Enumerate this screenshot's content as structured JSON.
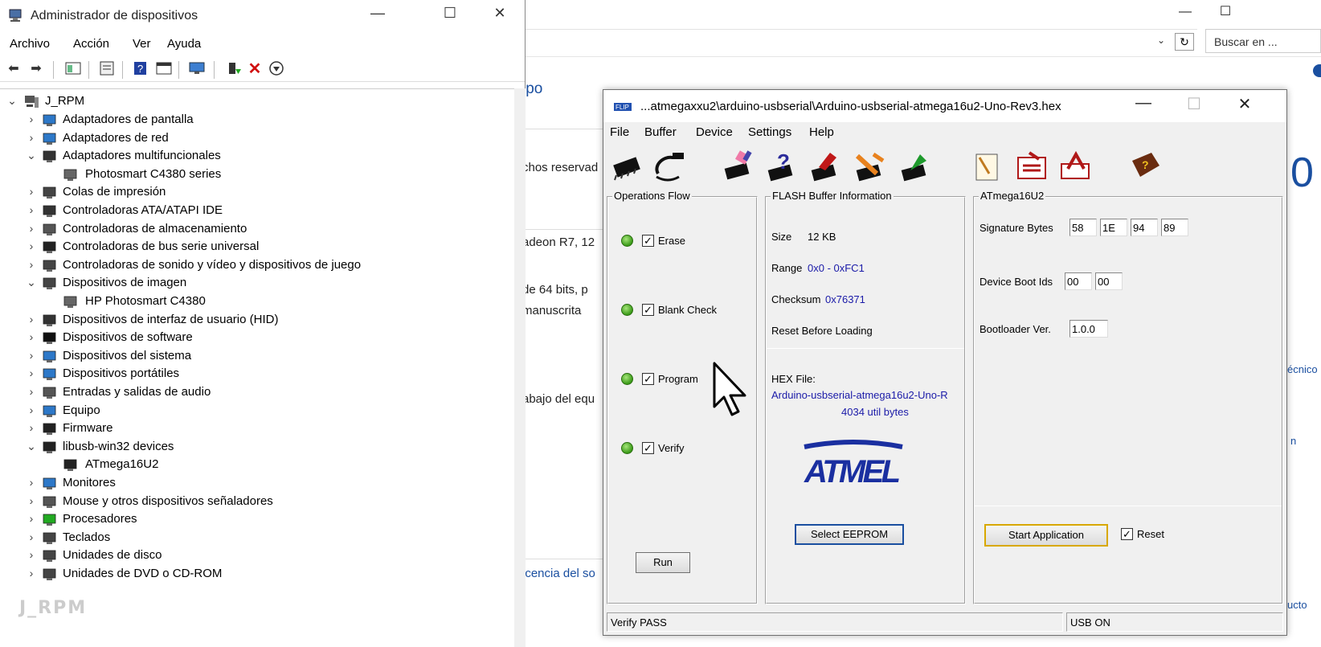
{
  "background_window": {
    "search_placeholder": "Buscar en ...",
    "snippets": [
      "ipo",
      "chos reservad",
      "adeon R7, 12",
      "de 64 bits, p",
      "manuscrita",
      "abajo del equ",
      "icencia del so",
      "0"
    ],
    "links": [
      "écnico",
      "n",
      "ucto"
    ]
  },
  "device_manager": {
    "title": "Administrador de dispositivos",
    "menu": [
      "Archivo",
      "Acción",
      "Ver",
      "Ayuda"
    ],
    "root": "J_RPM",
    "items": [
      {
        "label": "Adaptadores de pantalla",
        "expanded": false,
        "level": 1,
        "icon": "display-adapter-icon"
      },
      {
        "label": "Adaptadores de red",
        "expanded": false,
        "level": 1,
        "icon": "network-adapter-icon"
      },
      {
        "label": "Adaptadores multifuncionales",
        "expanded": true,
        "level": 1,
        "icon": "multifunction-icon"
      },
      {
        "label": "Photosmart C4380 series",
        "level": 2,
        "icon": "printer-device-icon"
      },
      {
        "label": "Colas de impresión",
        "expanded": false,
        "level": 1,
        "icon": "print-queue-icon"
      },
      {
        "label": "Controladoras ATA/ATAPI IDE",
        "expanded": false,
        "level": 1,
        "icon": "ide-controller-icon"
      },
      {
        "label": "Controladoras de almacenamiento",
        "expanded": false,
        "level": 1,
        "icon": "storage-controller-icon"
      },
      {
        "label": "Controladoras de bus serie universal",
        "expanded": false,
        "level": 1,
        "icon": "usb-controller-icon"
      },
      {
        "label": "Controladoras de sonido y vídeo y dispositivos de juego",
        "expanded": false,
        "level": 1,
        "icon": "sound-icon"
      },
      {
        "label": "Dispositivos de imagen",
        "expanded": true,
        "level": 1,
        "icon": "imaging-device-icon"
      },
      {
        "label": "HP Photosmart C4380",
        "level": 2,
        "icon": "scanner-icon"
      },
      {
        "label": "Dispositivos de interfaz de usuario (HID)",
        "expanded": false,
        "level": 1,
        "icon": "hid-icon"
      },
      {
        "label": "Dispositivos de software",
        "expanded": false,
        "level": 1,
        "icon": "software-device-icon"
      },
      {
        "label": "Dispositivos del sistema",
        "expanded": false,
        "level": 1,
        "icon": "system-device-icon"
      },
      {
        "label": "Dispositivos portátiles",
        "expanded": false,
        "level": 1,
        "icon": "portable-device-icon"
      },
      {
        "label": "Entradas y salidas de audio",
        "expanded": false,
        "level": 1,
        "icon": "audio-io-icon"
      },
      {
        "label": "Equipo",
        "expanded": false,
        "level": 1,
        "icon": "computer-icon"
      },
      {
        "label": "Firmware",
        "expanded": false,
        "level": 1,
        "icon": "firmware-icon"
      },
      {
        "label": "libusb-win32 devices",
        "expanded": true,
        "level": 1,
        "icon": "usb-plug-icon"
      },
      {
        "label": "ATmega16U2",
        "level": 2,
        "icon": "usb-plug-icon"
      },
      {
        "label": "Monitores",
        "expanded": false,
        "level": 1,
        "icon": "monitor-icon"
      },
      {
        "label": "Mouse y otros dispositivos señaladores",
        "expanded": false,
        "level": 1,
        "icon": "mouse-icon"
      },
      {
        "label": "Procesadores",
        "expanded": false,
        "level": 1,
        "icon": "processor-icon"
      },
      {
        "label": "Teclados",
        "expanded": false,
        "level": 1,
        "icon": "keyboard-icon"
      },
      {
        "label": "Unidades de disco",
        "expanded": false,
        "level": 1,
        "icon": "disk-drive-icon"
      },
      {
        "label": "Unidades de DVD o CD-ROM",
        "expanded": false,
        "level": 1,
        "icon": "dvd-drive-icon"
      }
    ],
    "watermark": "J_RPM"
  },
  "flip": {
    "title": "...atmegaxxu2\\arduino-usbserial\\Arduino-usbserial-atmega16u2-Uno-Rev3.hex",
    "menu": [
      "File",
      "Buffer",
      "Device",
      "Settings",
      "Help"
    ],
    "operations": {
      "title": "Operations Flow",
      "steps": [
        {
          "label": "Erase",
          "checked": true
        },
        {
          "label": "Blank Check",
          "checked": true
        },
        {
          "label": "Program",
          "checked": true
        },
        {
          "label": "Verify",
          "checked": true
        }
      ],
      "run_label": "Run"
    },
    "flash": {
      "title": "FLASH Buffer Information",
      "size_label": "Size",
      "size_value": "12 KB",
      "range_label": "Range",
      "range_value": "0x0 - 0xFC1",
      "checksum_label": "Checksum",
      "checksum_value": "0x76371",
      "reset_label": "Reset Before Loading",
      "hex_label": "HEX File:",
      "hex_file": "Arduino-usbserial-atmega16u2-Uno-R",
      "hex_bytes": "4034 util bytes",
      "logo_text": "ATMEL",
      "select_eeprom_label": "Select EEPROM"
    },
    "device": {
      "title": "ATmega16U2",
      "signature_label": "Signature Bytes",
      "signature": [
        "58",
        "1E",
        "94",
        "89"
      ],
      "boot_ids_label": "Device Boot Ids",
      "boot_ids": [
        "00",
        "00"
      ],
      "bootloader_label": "Bootloader Ver.",
      "bootloader_value": "1.0.0",
      "start_app_label": "Start Application",
      "reset_label": "Reset",
      "reset_checked": true
    },
    "status_left": "Verify PASS",
    "status_right": "USB ON"
  }
}
